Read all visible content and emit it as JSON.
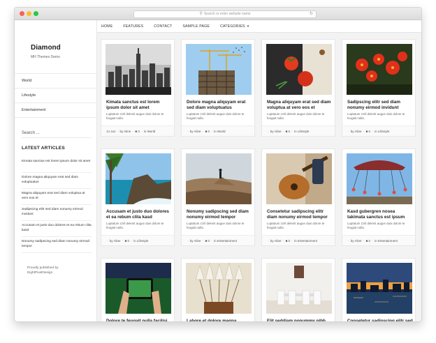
{
  "browser": {
    "address_placeholder": "Search or enter website name"
  },
  "sidebar": {
    "site_title": "Diamond",
    "tagline": "MH Themes Demo",
    "menu": [
      "World",
      "Lifestyle",
      "Entertainment"
    ],
    "search_placeholder": "Search ...",
    "latest_heading": "LATEST ARTICLES",
    "latest": [
      "Kimata sanctus est lorem ipsum dolor sit amet",
      "Dolore magna aliquyam erat sed diam voluptuatus",
      "Magna aliquyam erat sed diam voluptua at vero eos et",
      "Sadipscing elitr sed diam nonumy eirmod invidunt",
      "Accusam et justo duo dolores et ea rebum clita kasd",
      "Nonumy sadipscing sed diam nonumy eirmod tempor"
    ],
    "credit_line1": "Proudly published by",
    "credit_line2": "EightPixelDesign"
  },
  "nav": {
    "items": [
      "HOME",
      "FEATURES",
      "CONTACT",
      "SAMPLE PAGE",
      "CATEGORIES"
    ]
  },
  "excerpt_text": "Luptatum zzril delenit augue duis dolore te feugait nulla.",
  "posts": [
    {
      "title": "Kimata sanctus est lorem ipsum dolor sit amet",
      "date": "14 Jun",
      "author": "Aline",
      "comments": "0",
      "category": "World",
      "image": "city-skyline"
    },
    {
      "title": "Dolore magna aliquyam erat sed diam voluptuatus",
      "date": "",
      "author": "Aline",
      "comments": "0",
      "category": "World",
      "image": "construction-crane"
    },
    {
      "title": "Magna aliquyam erat sed diam voluptua at vero eos et",
      "date": "",
      "author": "Aline",
      "comments": "0",
      "category": "Lifestyle",
      "image": "tomatoes"
    },
    {
      "title": "Sadipscing elitr sed diam nonumy eirmod invidunt",
      "date": "",
      "author": "Aline",
      "comments": "0",
      "category": "Lifestyle",
      "image": "red-flowers"
    },
    {
      "title": "Accusam et justo duo dolores et ea rebum clita kasd",
      "date": "",
      "author": "Aline",
      "comments": "0",
      "category": "Lifestyle",
      "image": "coast-palm"
    },
    {
      "title": "Nonumy sadipscing sed diam nonumy eirmod tempor",
      "date": "",
      "author": "Aline",
      "comments": "0",
      "category": "Entertainment",
      "image": "cliff-person"
    },
    {
      "title": "Consetetur sadipscing elitr diam nonumy eirmod tempor",
      "date": "",
      "author": "Aline",
      "comments": "0",
      "category": "Entertainment",
      "image": "guitar"
    },
    {
      "title": "Kasd gubergren nosea takimata sanctus est ipsum",
      "date": "",
      "author": "Aline",
      "comments": "0",
      "category": "Entertainment",
      "image": "carousel"
    },
    {
      "title": "Dolore te feugait nulla facilisi orem ipsum dolor sit amet",
      "date": "",
      "author": "",
      "comments": "",
      "category": "",
      "image": "phone-stadium"
    },
    {
      "title": "Labore et dolore magna aliquyam erat sed diam voluptua",
      "date": "",
      "author": "",
      "comments": "",
      "category": "",
      "image": "arrows"
    },
    {
      "title": "Elit seddiam nonummy nibh euismod tincidunt",
      "date": "",
      "author": "",
      "comments": "",
      "category": "",
      "image": "dining-room"
    },
    {
      "title": "Consetetur sadipscing elitr sed diam nonumy eirmod tempor",
      "date": "",
      "author": "",
      "comments": "",
      "category": "",
      "image": "night-city"
    }
  ]
}
